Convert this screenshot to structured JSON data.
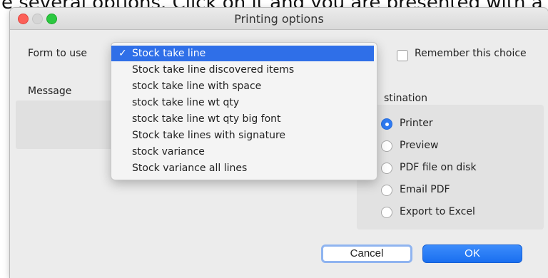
{
  "page_text": "e several options. Click on it and you are presented with a",
  "window": {
    "title": "Printing options"
  },
  "form": {
    "label": "Form to use",
    "options": [
      "Stock take line",
      "Stock take line discovered items",
      "stock take line with space",
      "stock take line wt qty",
      "stock take line wt qty big font",
      "Stock take lines with signature",
      "stock variance",
      "Stock variance all lines"
    ],
    "selected_index": 0
  },
  "remember_label": "Remember this choice",
  "message_label": "Message",
  "destination": {
    "label": "stination",
    "options": [
      "Printer",
      "Preview",
      "PDF file on disk",
      "Email PDF",
      "Export to Excel"
    ],
    "selected": "Printer"
  },
  "buttons": {
    "cancel": "Cancel",
    "ok": "OK"
  },
  "colors": {
    "accent": "#2f6fe8",
    "close": "#fc5f57",
    "maximize": "#2bc840"
  }
}
